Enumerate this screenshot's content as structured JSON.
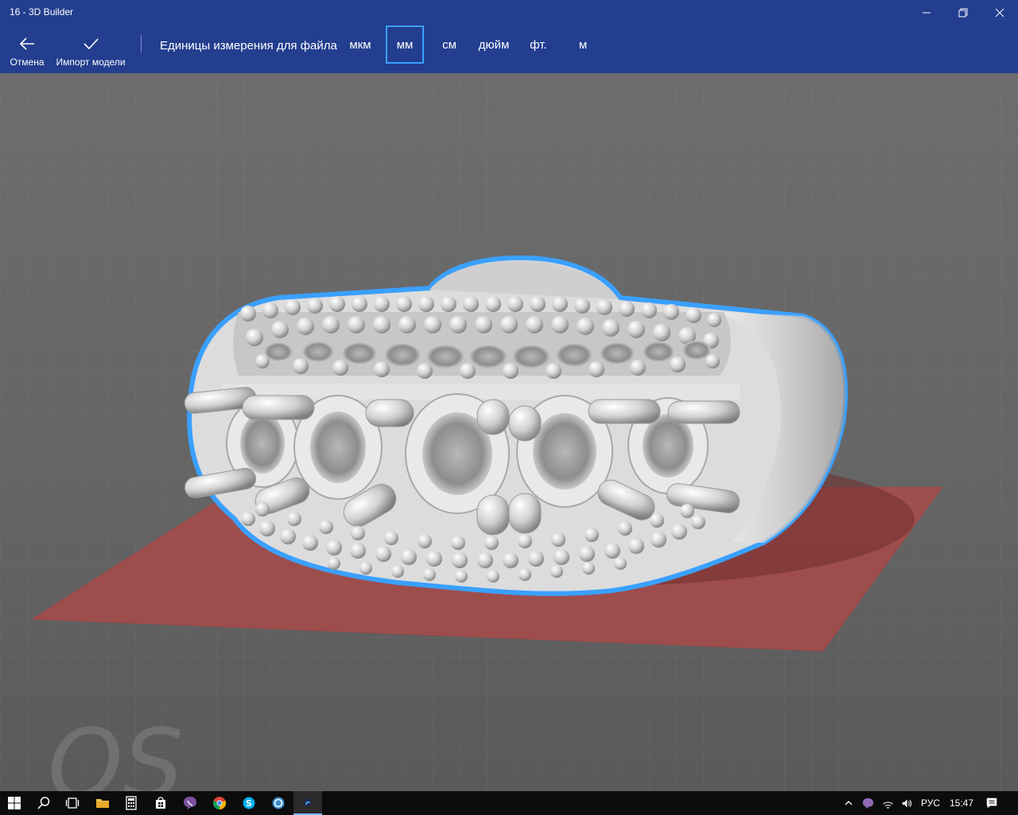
{
  "window": {
    "title": "16 - 3D Builder",
    "minimize_icon": "minimize-icon",
    "maximize_icon": "restore-icon",
    "close_icon": "close-icon"
  },
  "toolbar": {
    "cancel_label": "Отмена",
    "cancel_icon": "back-arrow-icon",
    "import_label": "Импорт модели",
    "import_icon": "checkmark-icon",
    "units_label": "Единицы измерения для файла",
    "units": [
      {
        "label": "мкм",
        "selected": false
      },
      {
        "label": "мм",
        "selected": true
      },
      {
        "label": "см",
        "selected": false
      },
      {
        "label": "дюйм",
        "selected": false
      },
      {
        "label": "фт.",
        "selected": false
      },
      {
        "label": "м",
        "selected": false
      }
    ]
  },
  "colors": {
    "accent": "#233e8f",
    "selection_outline": "#3aa0ff",
    "build_plate": "#b04848",
    "model": "#d9d9d9"
  },
  "taskbar": {
    "apps": [
      "windows-start-icon",
      "search-icon",
      "task-view-icon",
      "file-explorer-icon",
      "calculator-icon",
      "store-icon",
      "viber-icon",
      "chrome-icon",
      "skype-icon",
      "app-icon",
      "3d-builder-icon"
    ],
    "language": "РУС",
    "time": "15:47"
  }
}
